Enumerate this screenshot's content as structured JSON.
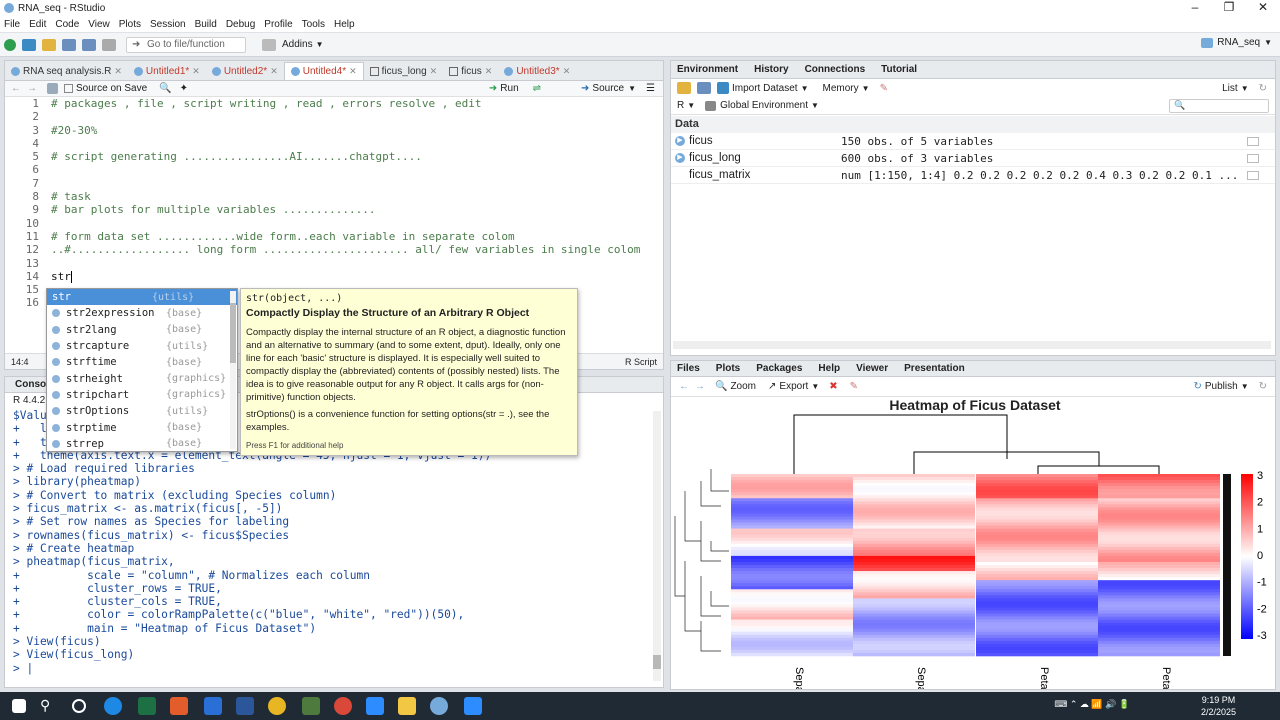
{
  "window": {
    "title": "RNA_seq - RStudio"
  },
  "menu": [
    "File",
    "Edit",
    "Code",
    "View",
    "Plots",
    "Session",
    "Build",
    "Debug",
    "Profile",
    "Tools",
    "Help"
  ],
  "toolbar": {
    "goto_placeholder": "Go to file/function",
    "addins": "Addins",
    "project": "RNA_seq"
  },
  "editor": {
    "tabs": [
      {
        "label": "RNA seq analysis.R",
        "type": "r",
        "unsaved": false
      },
      {
        "label": "Untitled1*",
        "type": "r",
        "unsaved": true
      },
      {
        "label": "Untitled2*",
        "type": "r",
        "unsaved": true
      },
      {
        "label": "Untitled4*",
        "type": "r",
        "unsaved": false,
        "active": true
      },
      {
        "label": "ficus_long",
        "type": "table",
        "unsaved": false
      },
      {
        "label": "ficus",
        "type": "table",
        "unsaved": false
      },
      {
        "label": "Untitled3*",
        "type": "r",
        "unsaved": true
      }
    ],
    "source_on_save": "Source on Save",
    "run_label": "Run",
    "source_label": "Source",
    "line_numbers": [
      "1",
      "2",
      "3",
      "4",
      "5",
      "6",
      "7",
      "8",
      "9",
      "10",
      "11",
      "12",
      "13",
      "14",
      "15",
      "16"
    ],
    "lines": [
      "# packages , file , script writing , read , errors resolve , edit",
      "",
      "#20-30%",
      "",
      "# script generating ................AI.......chatgpt....",
      "",
      "",
      "# task",
      "# bar plots for multiple variables ..............",
      "",
      "# form data set ............wide form..each variable in separate colom",
      "..#.................. long form ...................... all/ few variables in single colom",
      "",
      "str",
      "",
      ""
    ],
    "cursor_pos": "14:4",
    "file_type": "R Script"
  },
  "autocomplete": {
    "items": [
      {
        "name": "str",
        "pkg": "{utils}",
        "selected": true
      },
      {
        "name": "str2expression",
        "pkg": "{base}"
      },
      {
        "name": "str2lang",
        "pkg": "{base}"
      },
      {
        "name": "strcapture",
        "pkg": "{utils}"
      },
      {
        "name": "strftime",
        "pkg": "{base}"
      },
      {
        "name": "strheight",
        "pkg": "{graphics}"
      },
      {
        "name": "stripchart",
        "pkg": "{graphics}"
      },
      {
        "name": "strOptions",
        "pkg": "{utils}"
      },
      {
        "name": "strptime",
        "pkg": "{base}"
      },
      {
        "name": "strrep",
        "pkg": "{base}"
      }
    ],
    "help": {
      "signature": "str(object, ...)",
      "title": "Compactly Display the Structure of an Arbitrary R Object",
      "desc": "Compactly display the internal structure of an R object, a diagnostic function and an alternative to summary (and to some extent, dput). Ideally, only one line for each 'basic' structure is displayed. It is especially well suited to compactly display the (abbreviated) contents of (possibly nested) lists. The idea is to give reasonable output for any R object. It calls args for (non-primitive) function objects.",
      "desc2": "strOptions() is a convenience function for setting options(str = .), see the examples.",
      "footer": "Press F1 for additional help"
    }
  },
  "console": {
    "tab": "Console",
    "r_version": "R 4.4.2",
    "lines": [
      "$Value",
      "+   l",
      "+   t",
      "+   theme(axis.text.x = element_text(angle = 45, hjust = 1, vjust = 1))",
      "> # Load required libraries",
      "> library(pheatmap)",
      "> # Convert to matrix (excluding Species column)",
      "> ficus_matrix <- as.matrix(ficus[, -5])",
      "> # Set row names as Species for labeling",
      "> rownames(ficus_matrix) <- ficus$Species",
      "> # Create heatmap",
      "> pheatmap(ficus_matrix,",
      "+          scale = \"column\", # Normalizes each column",
      "+          cluster_rows = TRUE,",
      "+          cluster_cols = TRUE,",
      "+          color = colorRampPalette(c(\"blue\", \"white\", \"red\"))(50),",
      "+          main = \"Heatmap of Ficus Dataset\")",
      "> View(ficus)",
      "> View(ficus_long)",
      "> |"
    ]
  },
  "environment": {
    "tabs": [
      "Environment",
      "History",
      "Connections",
      "Tutorial"
    ],
    "import_dataset": "Import Dataset",
    "memory": "Memory",
    "list_view": "List",
    "lang": "R",
    "scope": "Global Environment",
    "section": "Data",
    "rows": [
      {
        "name": "ficus",
        "value": "150 obs. of 5 variables",
        "expandable": true
      },
      {
        "name": "ficus_long",
        "value": "600 obs. of 3 variables",
        "expandable": true
      },
      {
        "name": "ficus_matrix",
        "value": "num [1:150, 1:4] 0.2 0.2 0.2 0.2 0.2 0.4 0.3 0.2 0.2 0.1 ...",
        "expandable": false
      }
    ]
  },
  "plots": {
    "tabs": [
      "Files",
      "Plots",
      "Packages",
      "Help",
      "Viewer",
      "Presentation"
    ],
    "zoom": "Zoom",
    "export": "Export",
    "publish": "Publish",
    "title": "Heatmap of Ficus Dataset",
    "columns": [
      "Sepal_width",
      "Sepal_length",
      "Petal_width",
      "Petal_length"
    ],
    "legend_ticks": [
      "3",
      "2",
      "1",
      "0",
      "-1",
      "-2",
      "-3"
    ],
    "colors": {
      "low": "#0000ff",
      "mid": "#ffffff",
      "high": "#ff0000"
    }
  },
  "taskbar": {
    "time": "9:19 PM",
    "date": "2/2/2025"
  }
}
